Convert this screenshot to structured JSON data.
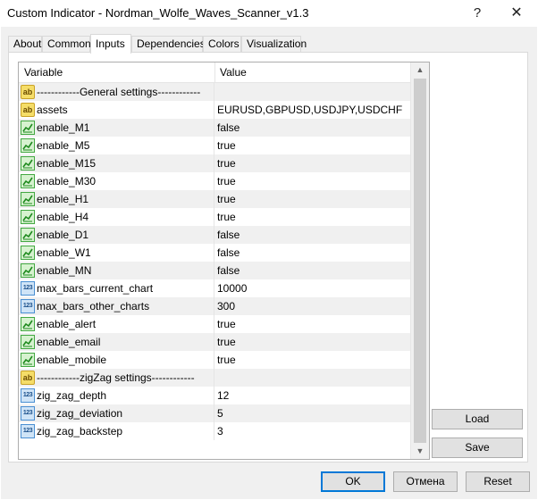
{
  "window": {
    "title": "Custom Indicator - Nordman_Wolfe_Waves_Scanner_v1.3",
    "help_glyph": "?",
    "close_glyph": "✕"
  },
  "tabs": [
    {
      "label": "About"
    },
    {
      "label": "Common"
    },
    {
      "label": "Inputs"
    },
    {
      "label": "Dependencies"
    },
    {
      "label": "Colors"
    },
    {
      "label": "Visualization"
    }
  ],
  "grid": {
    "header": {
      "variable": "Variable",
      "value": "Value"
    },
    "rows": [
      {
        "type": "string",
        "icon": "ab-string-icon",
        "name": "------------General settings------------",
        "value": ""
      },
      {
        "type": "string",
        "icon": "ab-string-icon",
        "name": "assets",
        "value": "EURUSD,GBPUSD,USDJPY,USDCHF"
      },
      {
        "type": "bool",
        "icon": "bool-chart-icon",
        "name": "enable_M1",
        "value": "false"
      },
      {
        "type": "bool",
        "icon": "bool-chart-icon",
        "name": "enable_M5",
        "value": "true"
      },
      {
        "type": "bool",
        "icon": "bool-chart-icon",
        "name": "enable_M15",
        "value": "true"
      },
      {
        "type": "bool",
        "icon": "bool-chart-icon",
        "name": "enable_M30",
        "value": "true"
      },
      {
        "type": "bool",
        "icon": "bool-chart-icon",
        "name": "enable_H1",
        "value": "true"
      },
      {
        "type": "bool",
        "icon": "bool-chart-icon",
        "name": "enable_H4",
        "value": "true"
      },
      {
        "type": "bool",
        "icon": "bool-chart-icon",
        "name": "enable_D1",
        "value": "false"
      },
      {
        "type": "bool",
        "icon": "bool-chart-icon",
        "name": "enable_W1",
        "value": "false"
      },
      {
        "type": "bool",
        "icon": "bool-chart-icon",
        "name": "enable_MN",
        "value": "false"
      },
      {
        "type": "int",
        "icon": "numeric-icon",
        "name": "max_bars_current_chart",
        "value": "10000"
      },
      {
        "type": "int",
        "icon": "numeric-icon",
        "name": "max_bars_other_charts",
        "value": "300"
      },
      {
        "type": "bool",
        "icon": "bool-chart-icon",
        "name": "enable_alert",
        "value": "true"
      },
      {
        "type": "bool",
        "icon": "bool-chart-icon",
        "name": "enable_email",
        "value": "true"
      },
      {
        "type": "bool",
        "icon": "bool-chart-icon",
        "name": "enable_mobile",
        "value": "true"
      },
      {
        "type": "string",
        "icon": "ab-string-icon",
        "name": "------------zigZag settings------------",
        "value": ""
      },
      {
        "type": "int",
        "icon": "numeric-icon",
        "name": "zig_zag_depth",
        "value": "12"
      },
      {
        "type": "int",
        "icon": "numeric-icon",
        "name": "zig_zag_deviation",
        "value": "5"
      },
      {
        "type": "int",
        "icon": "numeric-icon",
        "name": "zig_zag_backstep",
        "value": "3"
      }
    ]
  },
  "icons": {
    "ab_text": "ab",
    "num_text": "123"
  },
  "scrollbar": {
    "up_glyph": "▲",
    "down_glyph": "▼"
  },
  "side_buttons": {
    "load": "Load",
    "save": "Save"
  },
  "footer_buttons": {
    "ok": "OK",
    "cancel": "Отмена",
    "reset": "Reset"
  },
  "colors": {
    "accent": "#0078d7",
    "alt_row": "#f0f0f0"
  }
}
